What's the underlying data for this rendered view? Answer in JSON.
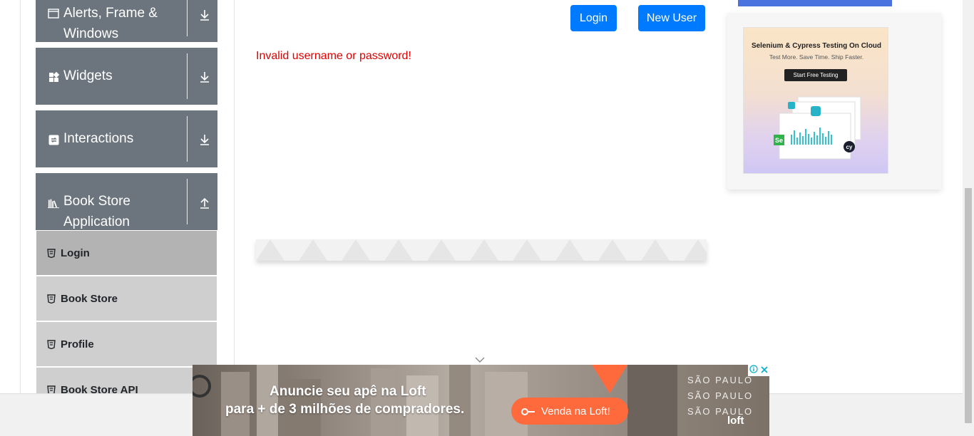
{
  "sidebar": {
    "groups": [
      {
        "label": "Alerts, Frame & Windows",
        "icon": "window-icon",
        "toggle": "download-arrow-icon"
      },
      {
        "label": "Widgets",
        "icon": "widgets-icon",
        "toggle": "download-arrow-icon"
      },
      {
        "label": "Interactions",
        "icon": "interactions-icon",
        "toggle": "download-arrow-icon"
      },
      {
        "label": "Book Store Application",
        "icon": "books-icon",
        "toggle": "upload-arrow-icon"
      }
    ],
    "items": [
      {
        "label": "Login",
        "active": true
      },
      {
        "label": "Book Store",
        "active": false
      },
      {
        "label": "Profile",
        "active": false
      },
      {
        "label": "Book Store API",
        "active": false
      }
    ]
  },
  "main": {
    "login_button": "Login",
    "new_user_button": "New User",
    "error_message": "Invalid username or password!",
    "error_color": "#e00000",
    "accent": "#007bff"
  },
  "side_ad": {
    "title": "Selenium & Cypress Testing On Cloud",
    "subtitle": "Test More. Save Time. Ship Faster.",
    "cta": "Start Free Testing",
    "badge_se": "Se",
    "badge_cy": "cy"
  },
  "banner_ad": {
    "line1": "Anuncie seu apê na Loft",
    "line2": "para + de 3 milhões de compradores.",
    "cta": "Venda na Loft!",
    "city_1": "SÃO PAULO",
    "city_2": "SÃO PAULO",
    "city_3": "SÃO PAULO",
    "logo": "loft",
    "cta_color": "#ff6a3d"
  }
}
